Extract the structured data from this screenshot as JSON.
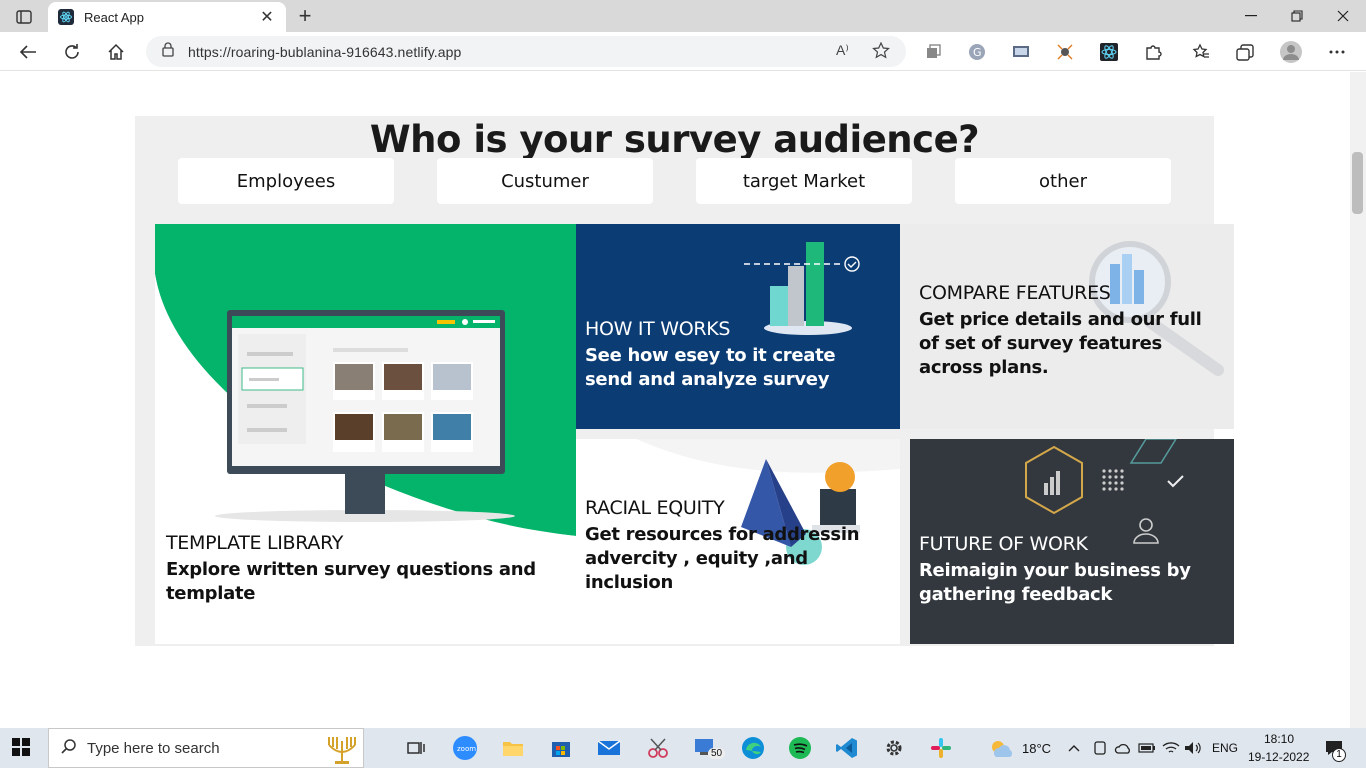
{
  "browser": {
    "tab_title": "React App",
    "tab_close": "✕",
    "new_tab": "+",
    "url": "https://roaring-bublanina-916643.netlify.app",
    "read_aloud": "A⁾"
  },
  "page": {
    "heading": "Who is your survey audience?",
    "audience_buttons": [
      "Employees",
      "Custumer",
      "target Market",
      "other"
    ],
    "cards": {
      "template": {
        "title": "TEMPLATE LIBRARY",
        "desc": "Explore written survey questions and template"
      },
      "how": {
        "title": "HOW IT WORKS",
        "desc": "See how esey to it create send and analyze survey"
      },
      "compare": {
        "title": "COMPARE FEATURES",
        "desc": "Get price details and our full of set of survey features across plans."
      },
      "racial": {
        "title": "RACIAL EQUITY",
        "desc": "Get resources for addressin advercity , equity ,and inclusion"
      },
      "future": {
        "title": "FUTURE OF WORK",
        "desc": "Reimaigin your business by gathering feedback"
      }
    },
    "colors": {
      "green": "#05b46b",
      "navy": "#0b3c74",
      "dark": "#33383f"
    }
  },
  "taskbar": {
    "search_placeholder": "Type here to search",
    "zoom_label": "zoom",
    "badge": "50",
    "weather": "18°C",
    "lang": "ENG",
    "time": "18:10",
    "date": "19-12-2022",
    "notif": "1"
  }
}
